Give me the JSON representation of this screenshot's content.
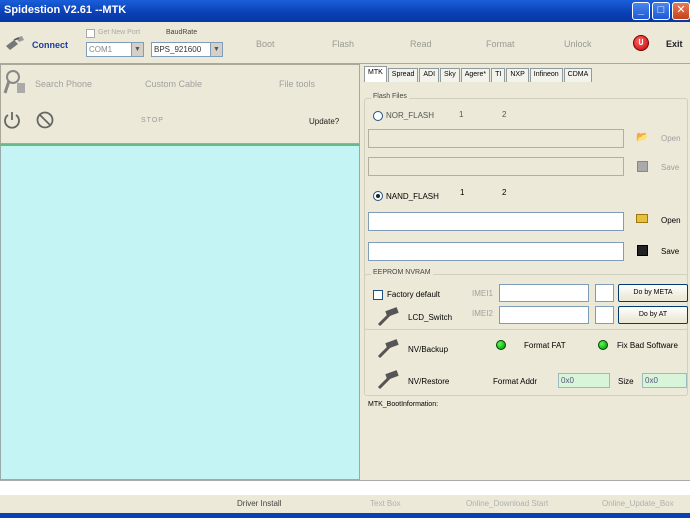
{
  "window": {
    "title": "Spidestion V2.61 --MTK"
  },
  "toolbar": {
    "connect": "Connect",
    "get_new_port": "Get New Port",
    "baudrate": "BaudRate",
    "port_value": "COM1",
    "baud_value": "BPS_921600",
    "boot": "Boot",
    "flash": "Flash",
    "read": "Read",
    "format": "Format",
    "unlock": "Unlock",
    "exit": "Exit"
  },
  "left_panel": {
    "search_phone": "Search Phone",
    "custom_cable": "Custom Cable",
    "file_tools": "File tools",
    "stop": "STOP",
    "update": "Update?"
  },
  "tabs": [
    "MTK",
    "Spread",
    "ADI",
    "Sky",
    "Agere*",
    "TI",
    "NXP",
    "Infineon",
    "CDMA"
  ],
  "flash_files": {
    "group": "Flash Files",
    "nor_label": "NOR_FLASH",
    "nor_num1": "1",
    "nor_num2": "2",
    "nor_open": "Open",
    "nor_save": "Save",
    "nand_label": "NAND_FLASH",
    "nand_num1": "1",
    "nand_num2": "2",
    "nand_open": "Open",
    "nand_save": "Save"
  },
  "eeprom": {
    "group": "EEPROM NVRAM",
    "factory_default": "Factory default",
    "imei1": "IMEI1",
    "imei2": "IMEI2",
    "do_by_meta": "Do by META",
    "do_by_at": "Do by AT",
    "lcd_switch": "LCD_Switch",
    "nv_backup": "NV/Backup",
    "nv_restore": "NV/Restore",
    "format_fat": "Format FAT",
    "fix_bad_software": "Fix Bad Software",
    "format_addr": "Format Addr",
    "format_addr_value": "0x0",
    "size": "Size",
    "size_value": "0x0"
  },
  "mtk_info": "MTK_BootInformation:",
  "statusbar": {
    "driver_install": "Driver Install",
    "text_box": "Text Box",
    "online_download": "Online_Download Start",
    "online_update": "Online_Update_Box"
  }
}
